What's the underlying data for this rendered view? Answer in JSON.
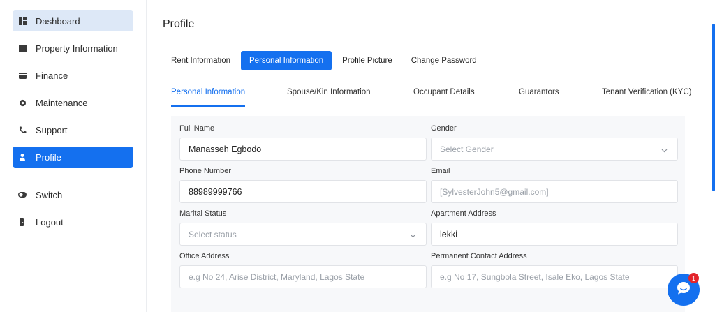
{
  "sidebar": {
    "items": [
      {
        "label": "Dashboard",
        "icon": "dashboard-icon"
      },
      {
        "label": "Property Information",
        "icon": "building-icon"
      },
      {
        "label": "Finance",
        "icon": "wallet-icon"
      },
      {
        "label": "Maintenance",
        "icon": "gear-icon"
      },
      {
        "label": "Support",
        "icon": "phone-icon"
      },
      {
        "label": "Profile",
        "icon": "user-icon"
      },
      {
        "label": "Switch",
        "icon": "switch-icon"
      },
      {
        "label": "Logout",
        "icon": "logout-icon"
      }
    ]
  },
  "page": {
    "title": "Profile"
  },
  "tabs": [
    "Rent Information",
    "Personal Information",
    "Profile Picture",
    "Change Password"
  ],
  "subtabs": [
    "Personal Information",
    "Spouse/Kin Information",
    "Occupant Details",
    "Guarantors",
    "Tenant Verification (KYC)"
  ],
  "form": {
    "full_name": {
      "label": "Full Name",
      "value": "Manasseh Egbodo"
    },
    "gender": {
      "label": "Gender",
      "placeholder": "Select Gender"
    },
    "phone": {
      "label": "Phone Number",
      "value": "88989999766"
    },
    "email": {
      "label": "Email",
      "placeholder": "[SylvesterJohn5@gmail.com]"
    },
    "marital": {
      "label": "Marital Status",
      "placeholder": "Select status"
    },
    "apartment": {
      "label": "Apartment Address",
      "value": "lekki"
    },
    "office": {
      "label": "Office Address",
      "placeholder": "e.g No 24, Arise District, Maryland, Lagos State"
    },
    "permanent": {
      "label": "Permanent Contact Address",
      "placeholder": "e.g No 17, Sungbola Street, Isale Eko, Lagos State"
    }
  },
  "chat": {
    "badge": "1"
  },
  "colors": {
    "accent": "#1470ef",
    "active_light": "#dde8f7",
    "badge": "#e3242b"
  }
}
